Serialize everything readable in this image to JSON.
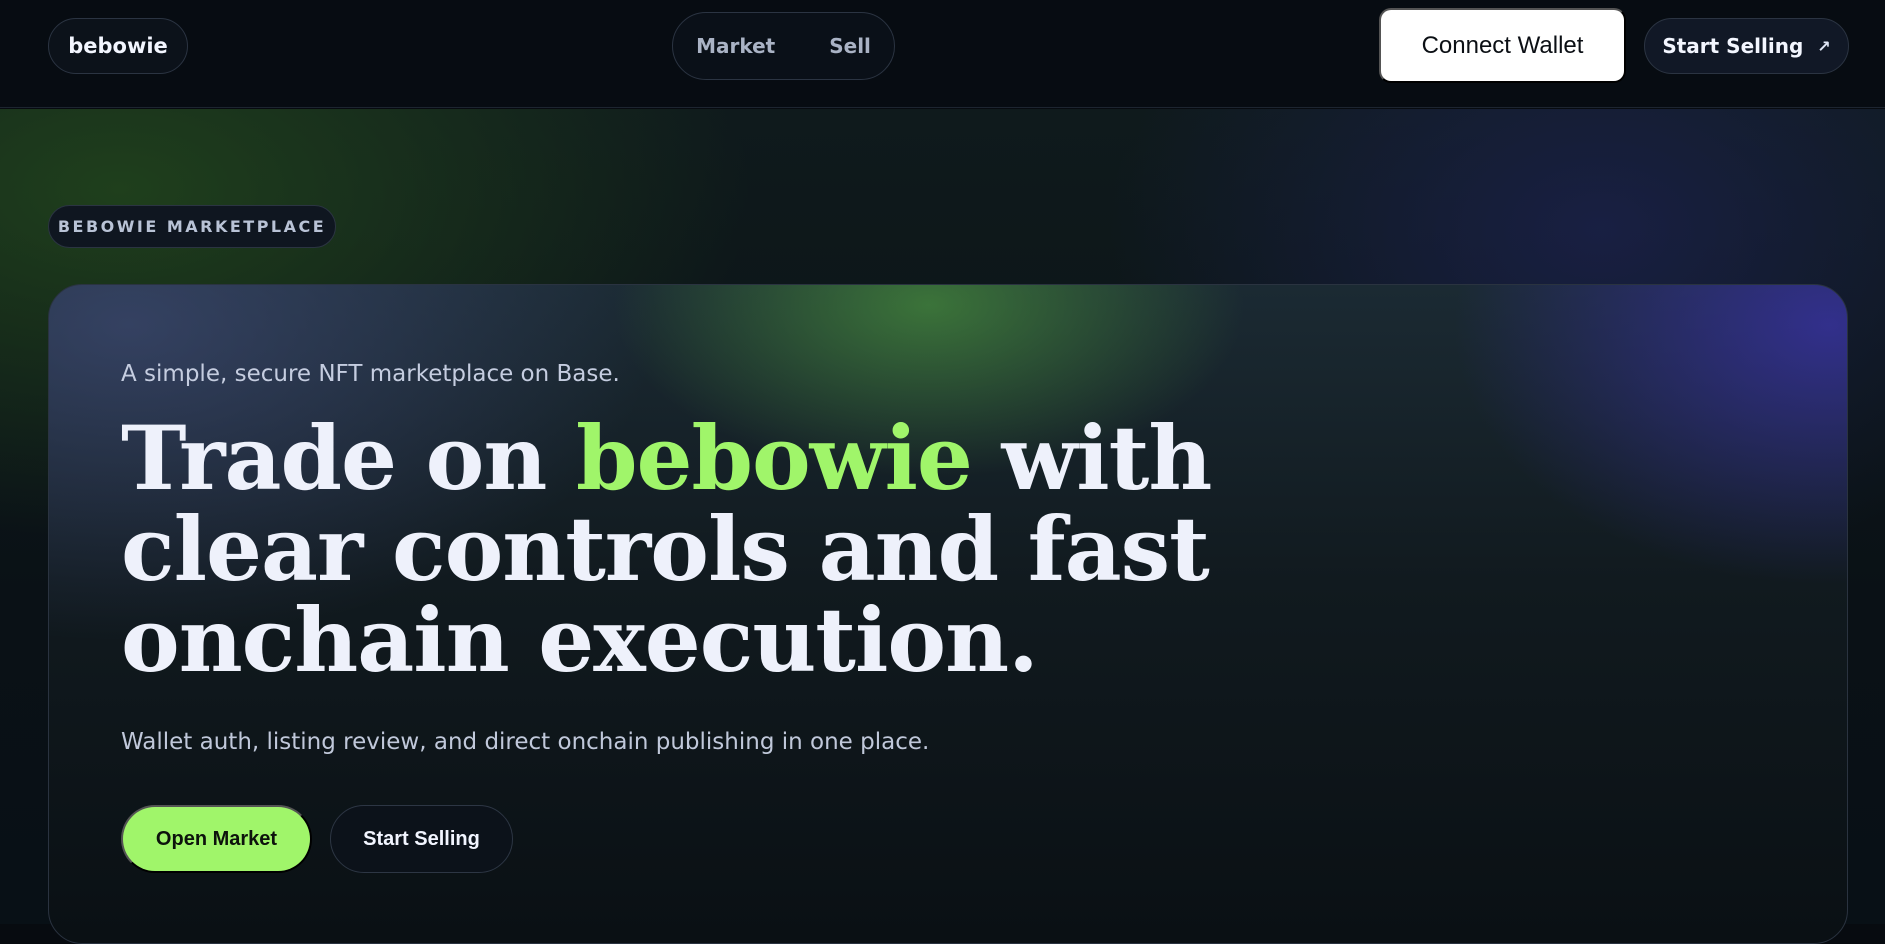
{
  "header": {
    "brand": "bebowie",
    "nav": [
      {
        "label": "Market"
      },
      {
        "label": "Sell"
      }
    ],
    "connect_label": "Connect Wallet",
    "start_selling_label": "Start Selling",
    "start_selling_icon": "arrow-up-right-icon"
  },
  "hero": {
    "eyebrow": "BEBOWIE MARKETPLACE",
    "tagline": "A simple, secure NFT marketplace on Base.",
    "headline_before": "Trade on ",
    "headline_accent": "bebowie",
    "headline_after": " with clear controls and fast onchain execution.",
    "subline": "Wallet auth, listing review, and direct onchain publishing in one place.",
    "primary_cta": "Open Market",
    "secondary_cta": "Start Selling"
  },
  "colors": {
    "accent": "#a0f56a",
    "background": "#070b10",
    "connect_button": "#ffffff"
  }
}
